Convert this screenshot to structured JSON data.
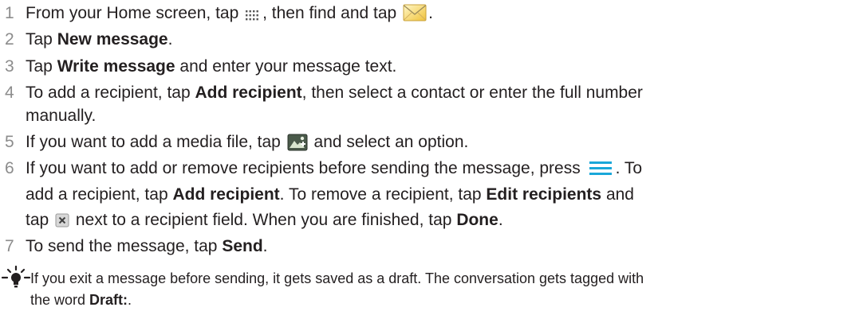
{
  "steps": [
    {
      "num": "1",
      "parts": [
        "From your Home screen, tap ",
        ", then find and tap ",
        "."
      ]
    },
    {
      "num": "2",
      "pre": "Tap ",
      "bold": "New message",
      "post": "."
    },
    {
      "num": "3",
      "pre": "Tap ",
      "bold": "Write message",
      "post": " and enter your message text."
    },
    {
      "num": "4",
      "pre": "To add a recipient, tap ",
      "bold": "Add recipient",
      "post": ", then select a contact or enter the full number",
      "line2": "manually."
    },
    {
      "num": "5",
      "pre": "If you want to add a media file, tap ",
      "post": " and select an option."
    },
    {
      "num": "6",
      "line1_pre": "If you want to add or remove recipients before sending the message, press ",
      "line1_post": ". To",
      "line2_pre": "add a recipient, tap ",
      "line2_b1": "Add recipient",
      "line2_mid": ". To remove a recipient, tap ",
      "line2_b2": "Edit recipients",
      "line2_post": " and",
      "line3_pre": "tap ",
      "line3_mid": " next to a recipient field. When you are finished, tap ",
      "line3_b": "Done",
      "line3_post": "."
    },
    {
      "num": "7",
      "pre": "To send the message, tap ",
      "bold": "Send",
      "post": "."
    }
  ],
  "tip": {
    "line1": "If you exit a message before sending, it gets saved as a draft. The conversation gets tagged with",
    "line2_pre": "the word ",
    "line2_b": "Draft:",
    "line2_post": "."
  },
  "icons": {
    "apps": "apps-grid-icon",
    "email": "envelope-icon",
    "media": "media-attach-icon",
    "menu": "menu-icon",
    "remove": "remove-x-icon",
    "tip": "lightbulb-tip-icon"
  },
  "colors": {
    "number": "#8c8c8c",
    "menu_icon": "#1aa7d9",
    "text": "#231f20"
  }
}
